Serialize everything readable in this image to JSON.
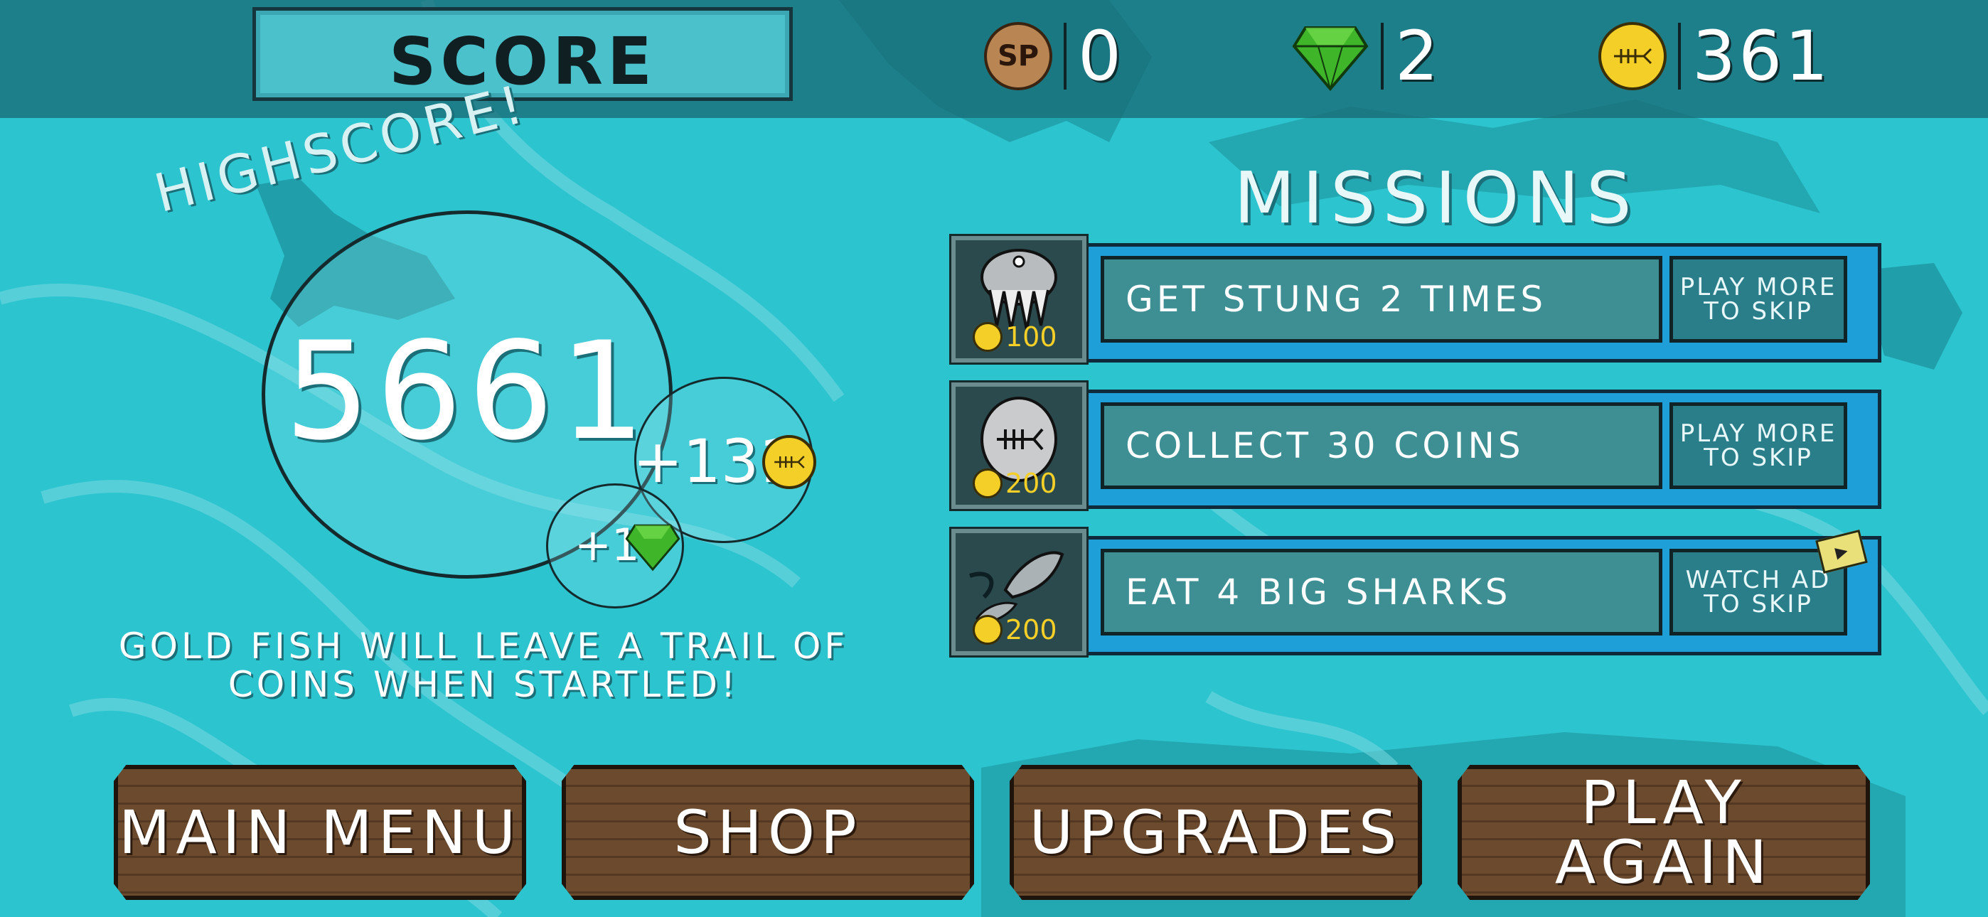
{
  "header": {
    "title": "SCORE",
    "currencies": [
      {
        "name": "sp",
        "icon": "sp-token-icon",
        "icon_text": "SP",
        "value": "0"
      },
      {
        "name": "gems",
        "icon": "green-gem-icon",
        "value": "2"
      },
      {
        "name": "coins",
        "icon": "fish-coin-icon",
        "value": "361"
      }
    ]
  },
  "score": {
    "highscore_label": "HIGHSCORE!",
    "value": "5661",
    "coins_earned": "+131",
    "gems_earned": "+1"
  },
  "tip": "GOLD FISH WILL LEAVE A TRAIL OF COINS WHEN STARTLED!",
  "missions": {
    "title": "MISSIONS",
    "items": [
      {
        "icon": "jellyfish-icon",
        "text": "GET STUNG 2 TIMES",
        "reward": "100",
        "action": "PLAY MORE TO SKIP"
      },
      {
        "icon": "silver-fish-coin-icon",
        "text": "COLLECT 30 COINS",
        "reward": "200",
        "action": "PLAY MORE TO SKIP"
      },
      {
        "icon": "sharks-icon",
        "text": "EAT 4 BIG SHARKS",
        "reward": "200",
        "action": "WATCH AD TO SKIP"
      }
    ]
  },
  "buttons": {
    "main_menu": "MAIN MENU",
    "shop": "SHOP",
    "upgrades": "UPGRADES",
    "play_again": "PLAY AGAIN"
  },
  "colors": {
    "water": "#2bc4cf",
    "top_bar": "#186c76",
    "mission_strip": "#1f9fd7",
    "wood": "#6b4a2e",
    "coin": "#f4cf27",
    "gem": "#3fb52a"
  }
}
